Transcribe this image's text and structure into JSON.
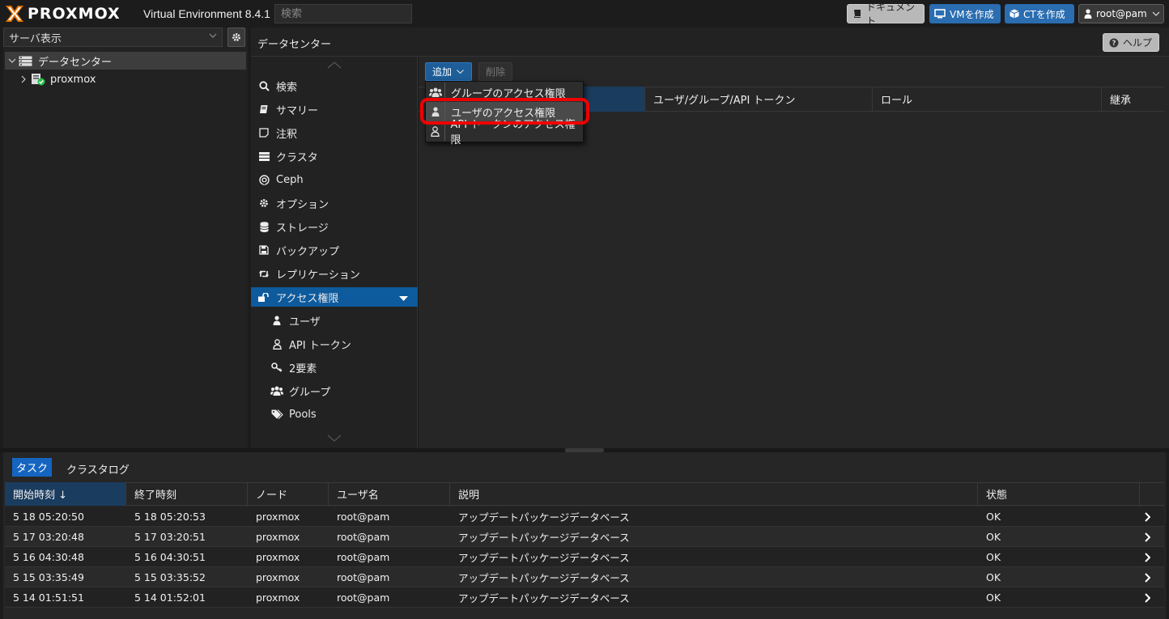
{
  "header": {
    "logo_text": "PROXMOX",
    "version": "Virtual Environment 8.4.1",
    "search_placeholder": "検索",
    "buttons": {
      "docs": "ドキュメント",
      "create_vm": "VMを作成",
      "create_ct": "CTを作成",
      "user": "root@pam"
    }
  },
  "tree": {
    "view_select": "サーバ表示",
    "datacenter": "データセンター",
    "node": "proxmox"
  },
  "content": {
    "title": "データセンター",
    "help": "ヘルプ"
  },
  "nav": {
    "items": [
      {
        "label": "検索",
        "icon": "search-icon"
      },
      {
        "label": "サマリー",
        "icon": "book-icon"
      },
      {
        "label": "注釈",
        "icon": "note-icon"
      },
      {
        "label": "クラスタ",
        "icon": "server-icon"
      },
      {
        "label": "Ceph",
        "icon": "ceph-icon"
      },
      {
        "label": "オプション",
        "icon": "gear-icon"
      },
      {
        "label": "ストレージ",
        "icon": "database-icon"
      },
      {
        "label": "バックアップ",
        "icon": "floppy-icon"
      },
      {
        "label": "レプリケーション",
        "icon": "retweet-icon"
      },
      {
        "label": "アクセス権限",
        "icon": "unlock-icon"
      },
      {
        "label": "ユーザ",
        "icon": "user-icon"
      },
      {
        "label": "API トークン",
        "icon": "user-outline-icon"
      },
      {
        "label": "2要素",
        "icon": "key-icon"
      },
      {
        "label": "グループ",
        "icon": "users-icon"
      },
      {
        "label": "Pools",
        "icon": "tags-icon"
      }
    ]
  },
  "toolbar": {
    "add": "追加",
    "delete": "削除"
  },
  "dropdown": {
    "items": [
      {
        "label": "グループのアクセス権限",
        "icon": "users-icon"
      },
      {
        "label": "ユーザのアクセス権限",
        "icon": "user-icon"
      },
      {
        "label": "API トークンのアクセス権限",
        "icon": "user-outline-icon"
      }
    ]
  },
  "grid": {
    "columns": [
      "ユーザ/グループ/API トークン",
      "ロール",
      "継承"
    ]
  },
  "bottom": {
    "tabs": [
      "タスク",
      "クラスタログ"
    ],
    "columns": [
      "開始時刻 ↓",
      "終了時刻",
      "ノード",
      "ユーザ名",
      "説明",
      "状態"
    ],
    "rows": [
      {
        "start": "5 18 05:20:50",
        "end": "5 18 05:20:53",
        "node": "proxmox",
        "user": "root@pam",
        "desc": "アップデートパッケージデータベース",
        "status": "OK"
      },
      {
        "start": "5 17 03:20:48",
        "end": "5 17 03:20:51",
        "node": "proxmox",
        "user": "root@pam",
        "desc": "アップデートパッケージデータベース",
        "status": "OK"
      },
      {
        "start": "5 16 04:30:48",
        "end": "5 16 04:30:51",
        "node": "proxmox",
        "user": "root@pam",
        "desc": "アップデートパッケージデータベース",
        "status": "OK"
      },
      {
        "start": "5 15 03:35:49",
        "end": "5 15 03:35:52",
        "node": "proxmox",
        "user": "root@pam",
        "desc": "アップデートパッケージデータベース",
        "status": "OK"
      },
      {
        "start": "5 14 01:51:51",
        "end": "5 14 01:52:01",
        "node": "proxmox",
        "user": "root@pam",
        "desc": "アップデートパッケージデータベース",
        "status": "OK"
      }
    ]
  }
}
